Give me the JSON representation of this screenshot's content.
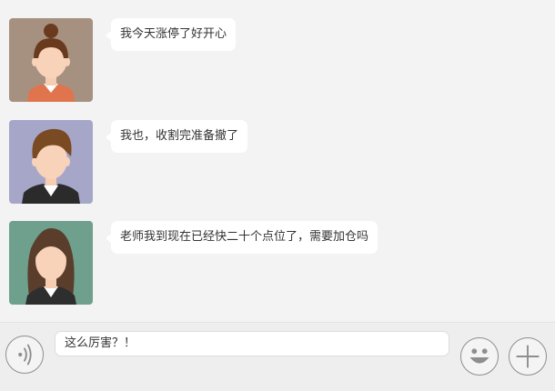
{
  "messages": [
    {
      "text": "我今天涨停了好开心",
      "avatar": "female-bun-avatar"
    },
    {
      "text": "我也，收割完准备撤了",
      "avatar": "male-suit-avatar"
    },
    {
      "text": "老师我到现在已经快二十个点位了，需要加仓吗",
      "avatar": "female-long-hair-avatar"
    }
  ],
  "input": {
    "value": "这么厉害？！"
  },
  "icons": {
    "voice": "voice-icon",
    "emoji": "emoji-icon",
    "plus": "plus-icon"
  },
  "colors": {
    "background": "#f3f3f3",
    "bubble": "#ffffff"
  }
}
